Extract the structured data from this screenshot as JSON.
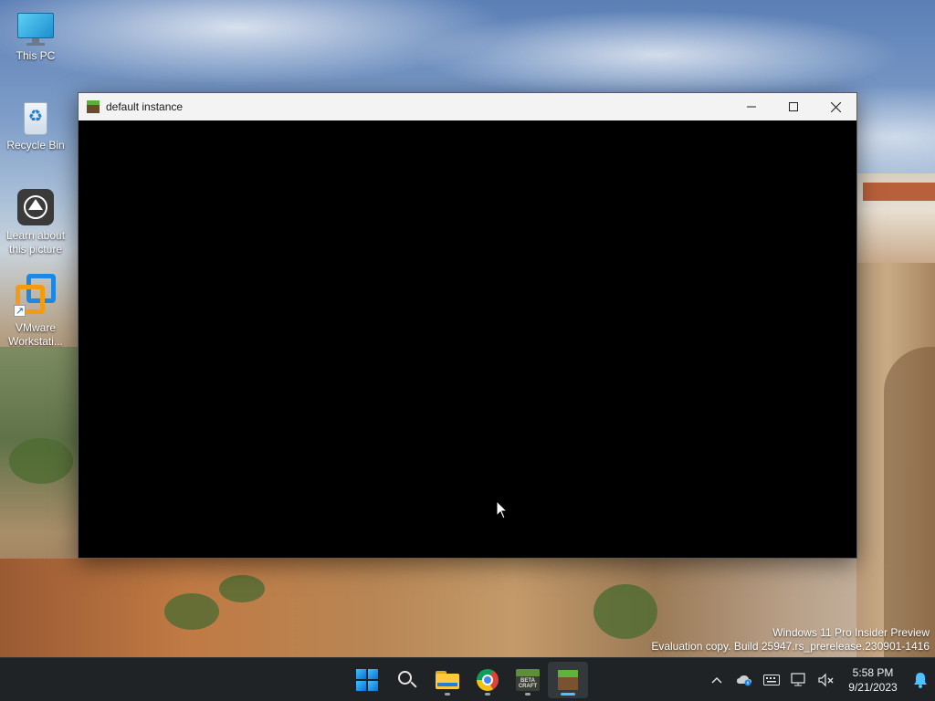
{
  "desktop": {
    "icons": [
      {
        "label": "This PC",
        "icon": "this-pc-icon"
      },
      {
        "label": "Recycle Bin",
        "icon": "recycle-bin-icon"
      },
      {
        "label": "Learn about this picture",
        "icon": "learn-about-picture-icon"
      },
      {
        "label": "VMware Workstati...",
        "icon": "vmware-workstation-icon"
      }
    ]
  },
  "window": {
    "title": "default instance",
    "icon": "minecraft-grass-block-icon",
    "controls": {
      "minimize": "minimize-icon",
      "maximize": "maximize-icon",
      "close": "close-icon"
    },
    "content_color": "#000000"
  },
  "watermark": {
    "line1": "Windows 11 Pro Insider Preview",
    "line2": "Evaluation copy. Build 25947.rs_prerelease.230901-1416"
  },
  "taskbar": {
    "apps": [
      {
        "name": "start",
        "icon": "windows-start-icon"
      },
      {
        "name": "search",
        "icon": "search-icon"
      },
      {
        "name": "file-explorer",
        "icon": "folder-icon",
        "running": true
      },
      {
        "name": "chrome",
        "icon": "chrome-icon",
        "running": true
      },
      {
        "name": "minecraft-launcher",
        "icon": "minecraft-launcher-icon",
        "running": true,
        "text": "BETA CRAFT"
      },
      {
        "name": "minecraft",
        "icon": "minecraft-grass-block-icon",
        "running": true,
        "active": true
      }
    ],
    "tray": {
      "icons": [
        "chevron-up-icon",
        "onedrive-icon",
        "keyboard-icon",
        "network-icon",
        "volume-muted-icon"
      ],
      "time": "5:58 PM",
      "date": "9/21/2023",
      "notification_icon": "bell-icon"
    },
    "colors": {
      "background": "#1f2326",
      "active_indicator": "#4cc2ff"
    }
  }
}
